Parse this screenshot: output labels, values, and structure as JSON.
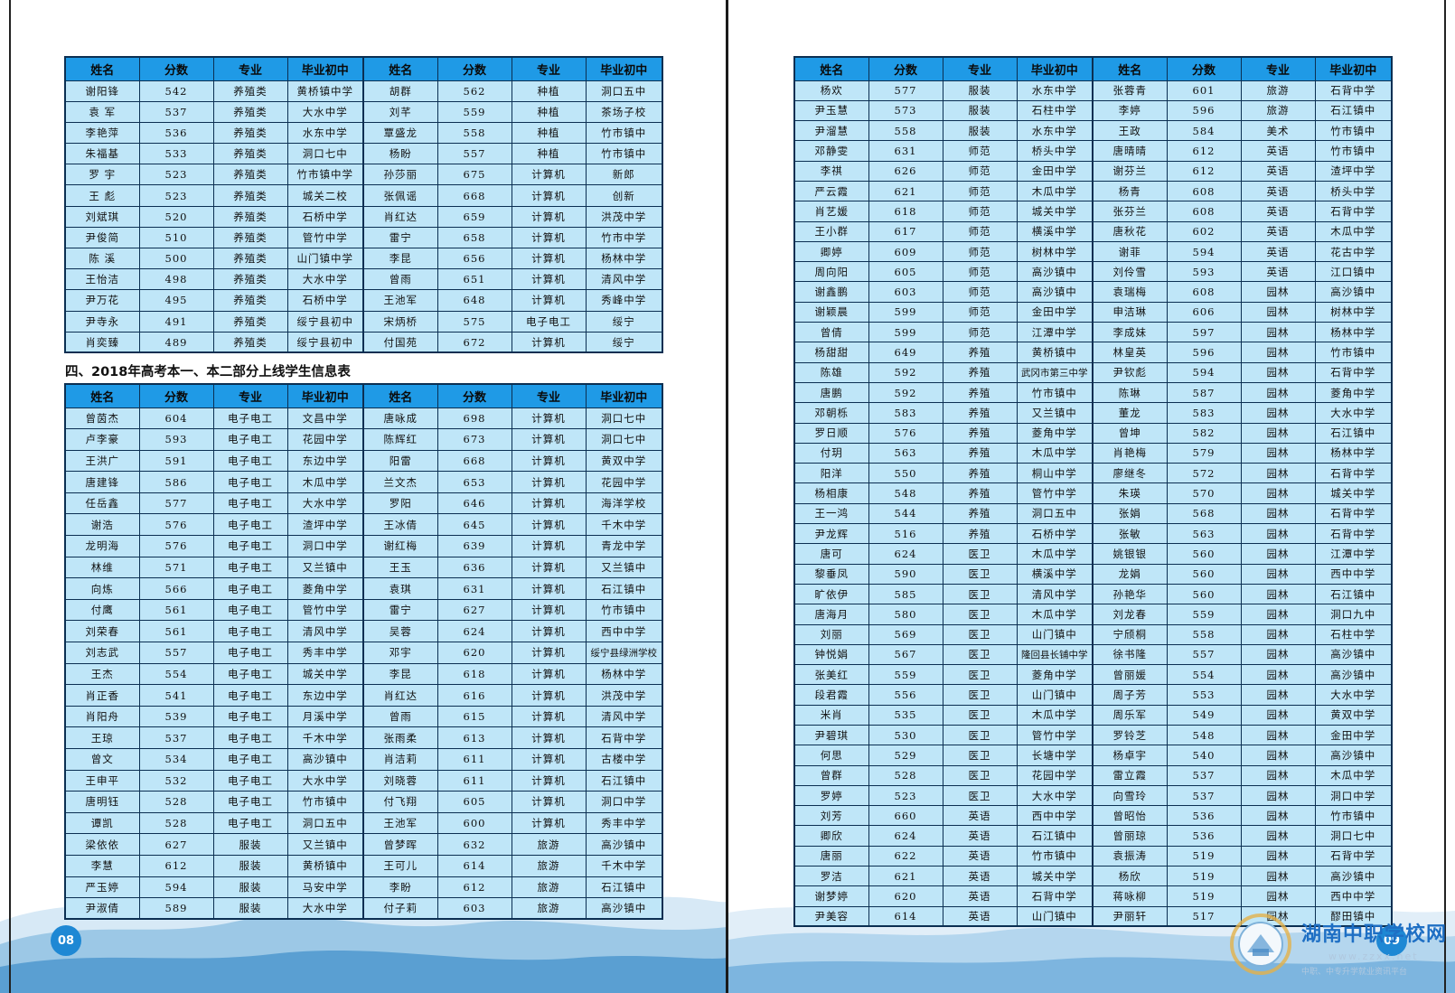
{
  "headers": [
    "姓名",
    "分数",
    "专业",
    "毕业初中",
    "姓名",
    "分数",
    "专业",
    "毕业初中"
  ],
  "section_title": "四、2018年高考本一、本二部分上线学生信息表",
  "page_left_number": "08",
  "page_right_number": "09",
  "watermark": {
    "name": "湖南中职学校网",
    "url": "www.zzxx.net",
    "slogan": "中职、中专升学就业资讯平台",
    "logo_icon": "school-emblem-icon"
  },
  "colors": {
    "header_bg": "#1f9ae6",
    "cell_bg": "#bfe6f8",
    "border": "#0b2f52",
    "page_badge": "#1e88d4"
  },
  "table_top_left": [
    [
      "谢阳锋",
      "542",
      "养殖类",
      "黄桥镇中学",
      "胡群",
      "562",
      "种植",
      "洞口五中"
    ],
    [
      "袁 军",
      "537",
      "养殖类",
      "大水中学",
      "刘芊",
      "559",
      "种植",
      "茶场子校"
    ],
    [
      "李艳萍",
      "536",
      "养殖类",
      "水东中学",
      "覃盛龙",
      "558",
      "种植",
      "竹市镇中"
    ],
    [
      "朱福基",
      "533",
      "养殖类",
      "洞口七中",
      "杨盼",
      "557",
      "种植",
      "竹市镇中"
    ],
    [
      "罗 宇",
      "523",
      "养殖类",
      "竹市镇中学",
      "孙莎丽",
      "675",
      "计算机",
      "新郎"
    ],
    [
      "王 彪",
      "523",
      "养殖类",
      "城关二校",
      "张佩谣",
      "668",
      "计算机",
      "创新"
    ],
    [
      "刘斌琪",
      "520",
      "养殖类",
      "石桥中学",
      "肖红达",
      "659",
      "计算机",
      "洪茂中学"
    ],
    [
      "尹俊简",
      "510",
      "养殖类",
      "管竹中学",
      "雷宁",
      "658",
      "计算机",
      "竹市中学"
    ],
    [
      "陈 溪",
      "500",
      "养殖类",
      "山门镇中学",
      "李昆",
      "656",
      "计算机",
      "杨林中学"
    ],
    [
      "王怡洁",
      "498",
      "养殖类",
      "大水中学",
      "曾雨",
      "651",
      "计算机",
      "清风中学"
    ],
    [
      "尹万花",
      "495",
      "养殖类",
      "石桥中学",
      "王池军",
      "648",
      "计算机",
      "秀峰中学"
    ],
    [
      "尹寺永",
      "491",
      "养殖类",
      "绥宁县初中",
      "宋炳桥",
      "575",
      "电子电工",
      "绥宁"
    ],
    [
      "肖奕臻",
      "489",
      "养殖类",
      "绥宁县初中",
      "付国苑",
      "672",
      "计算机",
      "绥宁"
    ]
  ],
  "table_bottom_left": [
    [
      "曾茵杰",
      "604",
      "电子电工",
      "文昌中学",
      "唐咏成",
      "698",
      "计算机",
      "洞口七中"
    ],
    [
      "卢李豪",
      "593",
      "电子电工",
      "花园中学",
      "陈辉红",
      "673",
      "计算机",
      "洞口七中"
    ],
    [
      "王洪广",
      "591",
      "电子电工",
      "东边中学",
      "阳雷",
      "668",
      "计算机",
      "黄双中学"
    ],
    [
      "唐建锋",
      "586",
      "电子电工",
      "木瓜中学",
      "兰文杰",
      "653",
      "计算机",
      "花园中学"
    ],
    [
      "任岳鑫",
      "577",
      "电子电工",
      "大水中学",
      "罗阳",
      "646",
      "计算机",
      "海洋学校"
    ],
    [
      "谢浩",
      "576",
      "电子电工",
      "渣坪中学",
      "王冰倩",
      "645",
      "计算机",
      "千木中学"
    ],
    [
      "龙明海",
      "576",
      "电子电工",
      "洞口中学",
      "谢红梅",
      "639",
      "计算机",
      "青龙中学"
    ],
    [
      "林维",
      "571",
      "电子电工",
      "又兰镇中",
      "王玉",
      "636",
      "计算机",
      "又兰镇中"
    ],
    [
      "向炼",
      "566",
      "电子电工",
      "菱角中学",
      "袁琪",
      "631",
      "计算机",
      "石江镇中"
    ],
    [
      "付鹰",
      "561",
      "电子电工",
      "管竹中学",
      "雷宁",
      "627",
      "计算机",
      "竹市镇中"
    ],
    [
      "刘荣春",
      "561",
      "电子电工",
      "清风中学",
      "吴蓉",
      "624",
      "计算机",
      "西中中学"
    ],
    [
      "刘志武",
      "557",
      "电子电工",
      "秀丰中学",
      "邓宇",
      "620",
      "计算机",
      "绥宁县绿洲学校"
    ],
    [
      "王杰",
      "554",
      "电子电工",
      "城关中学",
      "李昆",
      "618",
      "计算机",
      "杨林中学"
    ],
    [
      "肖正香",
      "541",
      "电子电工",
      "东边中学",
      "肖红达",
      "616",
      "计算机",
      "洪茂中学"
    ],
    [
      "肖阳舟",
      "539",
      "电子电工",
      "月溪中学",
      "曾雨",
      "615",
      "计算机",
      "清风中学"
    ],
    [
      "王琼",
      "537",
      "电子电工",
      "千木中学",
      "张雨柔",
      "613",
      "计算机",
      "石背中学"
    ],
    [
      "曾文",
      "534",
      "电子电工",
      "高沙镇中",
      "肖洁莉",
      "611",
      "计算机",
      "古楼中学"
    ],
    [
      "王申平",
      "532",
      "电子电工",
      "大水中学",
      "刘晓蓉",
      "611",
      "计算机",
      "石江镇中"
    ],
    [
      "唐明钰",
      "528",
      "电子电工",
      "竹市镇中",
      "付飞翔",
      "605",
      "计算机",
      "洞口中学"
    ],
    [
      "谭凯",
      "528",
      "电子电工",
      "洞口五中",
      "王池军",
      "600",
      "计算机",
      "秀丰中学"
    ],
    [
      "梁依依",
      "627",
      "服装",
      "又兰镇中",
      "曾梦晖",
      "632",
      "旅游",
      "高沙镇中"
    ],
    [
      "李慧",
      "612",
      "服装",
      "黄桥镇中",
      "王可儿",
      "614",
      "旅游",
      "千木中学"
    ],
    [
      "严玉婷",
      "594",
      "服装",
      "马安中学",
      "李盼",
      "612",
      "旅游",
      "石江镇中"
    ],
    [
      "尹淑倩",
      "589",
      "服装",
      "大水中学",
      "付子莉",
      "603",
      "旅游",
      "高沙镇中"
    ]
  ],
  "table_right": [
    [
      "杨欢",
      "577",
      "服装",
      "水东中学",
      "张蓉青",
      "601",
      "旅游",
      "石背中学"
    ],
    [
      "尹玉慧",
      "573",
      "服装",
      "石柱中学",
      "李婷",
      "596",
      "旅游",
      "石江镇中"
    ],
    [
      "尹溜慧",
      "558",
      "服装",
      "水东中学",
      "王政",
      "584",
      "美术",
      "竹市镇中"
    ],
    [
      "邓静雯",
      "631",
      "师范",
      "桥头中学",
      "唐晴晴",
      "612",
      "英语",
      "竹市镇中"
    ],
    [
      "李祺",
      "626",
      "师范",
      "金田中学",
      "谢芬兰",
      "612",
      "英语",
      "渣坪中学"
    ],
    [
      "严云霞",
      "621",
      "师范",
      "木瓜中学",
      "杨青",
      "608",
      "英语",
      "桥头中学"
    ],
    [
      "肖艺媛",
      "618",
      "师范",
      "城关中学",
      "张芬兰",
      "608",
      "英语",
      "石背中学"
    ],
    [
      "王小群",
      "617",
      "师范",
      "横溪中学",
      "唐秋花",
      "602",
      "英语",
      "木瓜中学"
    ],
    [
      "卿婷",
      "609",
      "师范",
      "树林中学",
      "谢菲",
      "594",
      "英语",
      "花古中学"
    ],
    [
      "周向阳",
      "605",
      "师范",
      "高沙镇中",
      "刘伶雪",
      "593",
      "英语",
      "江口镇中"
    ],
    [
      "谢鑫鹏",
      "603",
      "师范",
      "高沙镇中",
      "袁瑞梅",
      "608",
      "园林",
      "高沙镇中"
    ],
    [
      "谢颖晨",
      "599",
      "师范",
      "金田中学",
      "申洁琳",
      "606",
      "园林",
      "树林中学"
    ],
    [
      "曾倩",
      "599",
      "师范",
      "江潭中学",
      "李成妹",
      "597",
      "园林",
      "杨林中学"
    ],
    [
      "杨甜甜",
      "649",
      "养殖",
      "黄桥镇中",
      "林皇英",
      "596",
      "园林",
      "竹市镇中"
    ],
    [
      "陈雄",
      "592",
      "养殖",
      "武冈市第三中学",
      "尹钦彪",
      "594",
      "园林",
      "石背中学"
    ],
    [
      "唐鹏",
      "592",
      "养殖",
      "竹市镇中",
      "陈琳",
      "587",
      "园林",
      "菱角中学"
    ],
    [
      "邓朝栎",
      "583",
      "养殖",
      "又兰镇中",
      "董龙",
      "583",
      "园林",
      "大水中学"
    ],
    [
      "罗日顺",
      "576",
      "养殖",
      "菱角中学",
      "曾坤",
      "582",
      "园林",
      "石江镇中"
    ],
    [
      "付玥",
      "563",
      "养殖",
      "木瓜中学",
      "肖艳梅",
      "579",
      "园林",
      "杨林中学"
    ],
    [
      "阳洋",
      "550",
      "养殖",
      "桐山中学",
      "廖继冬",
      "572",
      "园林",
      "石背中学"
    ],
    [
      "杨相康",
      "548",
      "养殖",
      "管竹中学",
      "朱瑛",
      "570",
      "园林",
      "城关中学"
    ],
    [
      "王一鸿",
      "544",
      "养殖",
      "洞口五中",
      "张娟",
      "568",
      "园林",
      "石背中学"
    ],
    [
      "尹龙辉",
      "516",
      "养殖",
      "石桥中学",
      "张敏",
      "563",
      "园林",
      "石背中学"
    ],
    [
      "唐可",
      "624",
      "医卫",
      "木瓜中学",
      "姚银银",
      "560",
      "园林",
      "江潭中学"
    ],
    [
      "黎垂凤",
      "590",
      "医卫",
      "横溪中学",
      "龙娟",
      "560",
      "园林",
      "西中中学"
    ],
    [
      "旷依伊",
      "585",
      "医卫",
      "清风中学",
      "孙艳华",
      "560",
      "园林",
      "石江镇中"
    ],
    [
      "唐海月",
      "580",
      "医卫",
      "木瓜中学",
      "刘龙春",
      "559",
      "园林",
      "洞口九中"
    ],
    [
      "刘丽",
      "569",
      "医卫",
      "山门镇中",
      "宁颀桐",
      "558",
      "园林",
      "石柱中学"
    ],
    [
      "钟悦娟",
      "567",
      "医卫",
      "隆回县长铺中学",
      "徐书隆",
      "557",
      "园林",
      "高沙镇中"
    ],
    [
      "张美红",
      "559",
      "医卫",
      "菱角中学",
      "曾丽媛",
      "554",
      "园林",
      "高沙镇中"
    ],
    [
      "段君霞",
      "556",
      "医卫",
      "山门镇中",
      "周子芳",
      "553",
      "园林",
      "大水中学"
    ],
    [
      "米肖",
      "535",
      "医卫",
      "木瓜中学",
      "周乐军",
      "549",
      "园林",
      "黄双中学"
    ],
    [
      "尹碧琪",
      "530",
      "医卫",
      "管竹中学",
      "罗铃芝",
      "548",
      "园林",
      "金田中学"
    ],
    [
      "何思",
      "529",
      "医卫",
      "长塘中学",
      "杨卓宇",
      "540",
      "园林",
      "高沙镇中"
    ],
    [
      "曾群",
      "528",
      "医卫",
      "花园中学",
      "雷立霞",
      "537",
      "园林",
      "木瓜中学"
    ],
    [
      "罗婷",
      "523",
      "医卫",
      "大水中学",
      "向雪玲",
      "537",
      "园林",
      "洞口中学"
    ],
    [
      "刘芳",
      "660",
      "英语",
      "西中中学",
      "曾昭怡",
      "536",
      "园林",
      "竹市镇中"
    ],
    [
      "卿欣",
      "624",
      "英语",
      "石江镇中",
      "曾丽琼",
      "536",
      "园林",
      "洞口七中"
    ],
    [
      "唐丽",
      "622",
      "英语",
      "竹市镇中",
      "袁振涛",
      "519",
      "园林",
      "石背中学"
    ],
    [
      "罗洁",
      "621",
      "英语",
      "城关中学",
      "杨欣",
      "519",
      "园林",
      "高沙镇中"
    ],
    [
      "谢梦婷",
      "620",
      "英语",
      "石背中学",
      "蒋咏柳",
      "519",
      "园林",
      "西中中学"
    ],
    [
      "尹美容",
      "614",
      "英语",
      "山门镇中",
      "尹丽轩",
      "517",
      "园林",
      "醪田镇中"
    ]
  ]
}
